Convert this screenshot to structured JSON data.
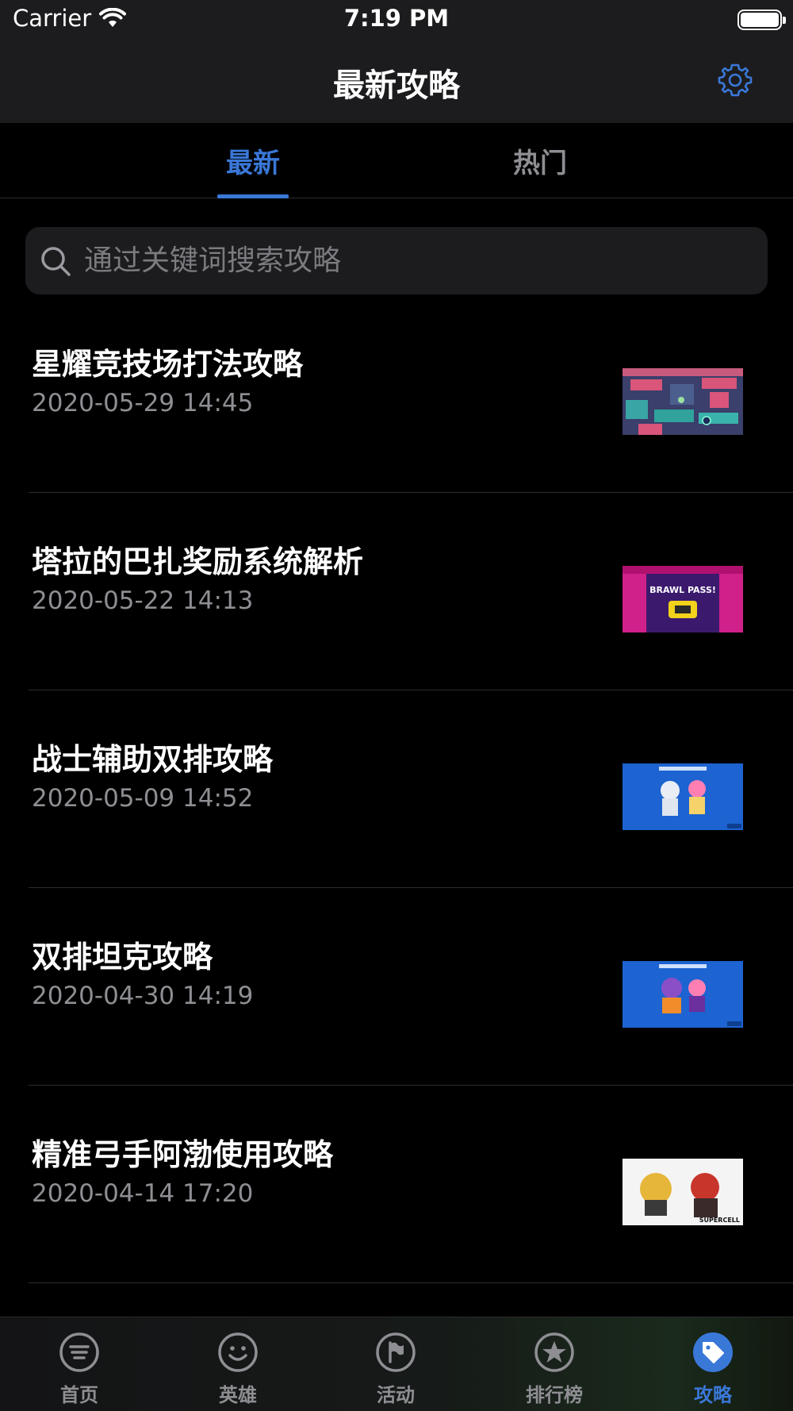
{
  "status_bar": {
    "carrier": "Carrier",
    "time": "7:19 PM"
  },
  "nav": {
    "title": "最新攻略",
    "settings_icon": "gear-icon"
  },
  "tabs": [
    {
      "label": "最新",
      "selected": true
    },
    {
      "label": "热门",
      "selected": false
    }
  ],
  "search": {
    "placeholder": "通过关键词搜索攻略",
    "value": ""
  },
  "articles": [
    {
      "title": "星耀竞技场打法攻略",
      "date": "2020-05-29 14:45",
      "thumb": "arena-map"
    },
    {
      "title": "塔拉的巴扎奖励系统解析",
      "date": "2020-05-22 14:13",
      "thumb": "brawl-pass"
    },
    {
      "title": "战士辅助双排攻略",
      "date": "2020-05-09 14:52",
      "thumb": "duo-victory"
    },
    {
      "title": "双排坦克攻略",
      "date": "2020-04-30 14:19",
      "thumb": "duo-victory"
    },
    {
      "title": "精准弓手阿渤使用攻略",
      "date": "2020-04-14 17:20",
      "thumb": "supercell-art"
    }
  ],
  "thumb_text": {
    "brawl_pass": "BRAWL PASS!",
    "supercell": "SUPERCELL"
  },
  "tabbar": [
    {
      "label": "首页",
      "icon": "menu-icon",
      "active": false
    },
    {
      "label": "英雄",
      "icon": "smiley-icon",
      "active": false
    },
    {
      "label": "活动",
      "icon": "flag-icon",
      "active": false
    },
    {
      "label": "排行榜",
      "icon": "star-icon",
      "active": false
    },
    {
      "label": "攻略",
      "icon": "tag-icon",
      "active": true
    }
  ],
  "colors": {
    "accent": "#3a78d8",
    "secondary_text": "#8e8e93",
    "background": "#000000",
    "bar": "#1c1c1e"
  }
}
